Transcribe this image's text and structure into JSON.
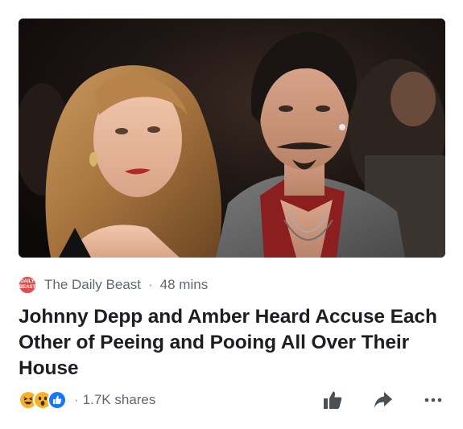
{
  "post": {
    "source_logo_text": "DAILY BEAST",
    "source_name": "The Daily Beast",
    "separator": "·",
    "time": "48 mins",
    "headline": "Johnny Depp and Amber Heard Accuse Each Other of Peeing and Pooing All Over Their House",
    "share_separator": "·",
    "shares": "1.7K shares"
  },
  "reactions": [
    "haha-icon",
    "wow-icon",
    "like-icon"
  ],
  "actions": [
    "like-icon",
    "share-arrow-icon",
    "more-icon"
  ],
  "colors": {
    "text_primary": "#1c1e21",
    "text_secondary": "#606770",
    "logo_red": "#e14b4b",
    "action_gray": "#4b4f56",
    "like_blue": "#1877f2",
    "haha_yellow": "#f7b125"
  }
}
